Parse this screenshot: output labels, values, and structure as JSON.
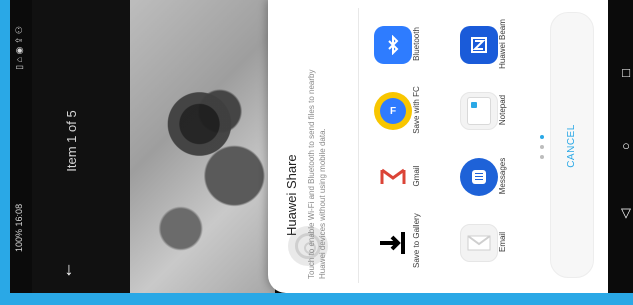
{
  "status": {
    "time": "16:08",
    "battery": "100%",
    "left_icons": "▯ ⌂ ◉ ⇪ ⚇"
  },
  "viewer": {
    "item_count": "Item 1 of 5",
    "back_icon": "back-arrow-icon"
  },
  "huawei_share": {
    "title": "Huawei Share",
    "description": "Touch to enable Wi-Fi and Bluetooth to send files to nearby Huawei devices without using mobile data."
  },
  "apps": [
    {
      "name": "Bluetooth",
      "icon": "bluetooth-icon"
    },
    {
      "name": "Huawei Beam",
      "icon": "huawei-beam-icon"
    },
    {
      "name": "Save with FC",
      "icon": "fc-icon"
    },
    {
      "name": "Notepad",
      "icon": "notepad-icon"
    },
    {
      "name": "Gmail",
      "icon": "gmail-icon"
    },
    {
      "name": "Messages",
      "icon": "messages-icon"
    },
    {
      "name": "Save to Gallery",
      "icon": "save-to-gallery-icon"
    },
    {
      "name": "Email",
      "icon": "email-icon"
    }
  ],
  "cancel_label": "CANCEL",
  "navigation": {
    "square_icon": "recent-apps-icon",
    "home_icon": "home-icon",
    "back_icon": "back-icon"
  }
}
